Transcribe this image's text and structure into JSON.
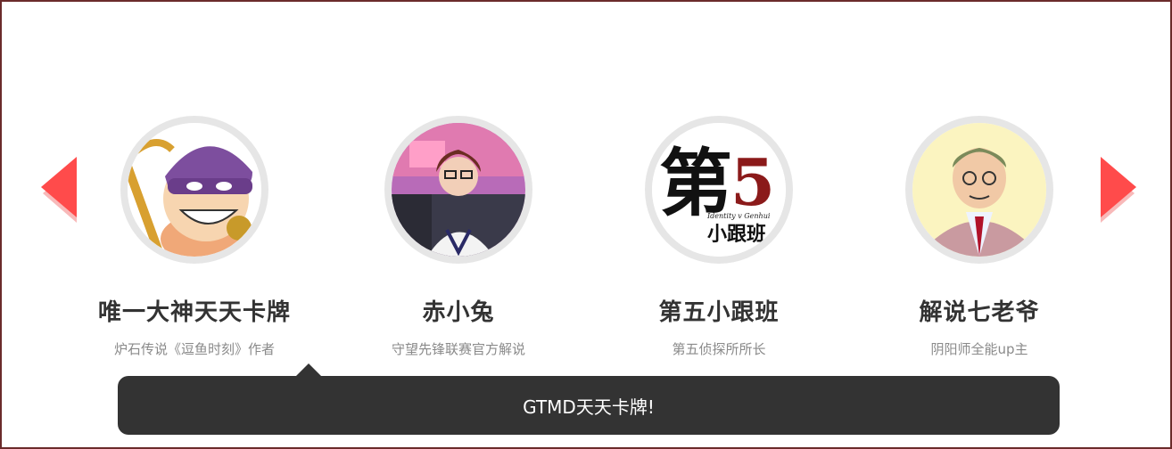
{
  "carousel": {
    "prev_icon": "triangle-left-icon",
    "next_icon": "triangle-right-icon",
    "accent_color": "#ff4b4b",
    "items": [
      {
        "name": "唯一大神天天卡牌",
        "desc": "炉石传说《逗鱼时刻》作者",
        "avatar": "cartoon-thief-avatar"
      },
      {
        "name": "赤小兔",
        "desc": "守望先锋联赛官方解说",
        "avatar": "streamer-photo-avatar"
      },
      {
        "name": "第五小跟班",
        "desc": "第五侦探所所长",
        "avatar": "identity-v-logo-avatar",
        "logo_text": {
          "main": "第",
          "num": "5",
          "sub": "Identity v Genhui",
          "cn": "小跟班"
        }
      },
      {
        "name": "解说七老爷",
        "desc": "阴阳师全能up主",
        "avatar": "cartoon-old-man-avatar"
      }
    ]
  },
  "tooltip": {
    "text": "GTMD天天卡牌!",
    "bg_color": "#333333"
  }
}
